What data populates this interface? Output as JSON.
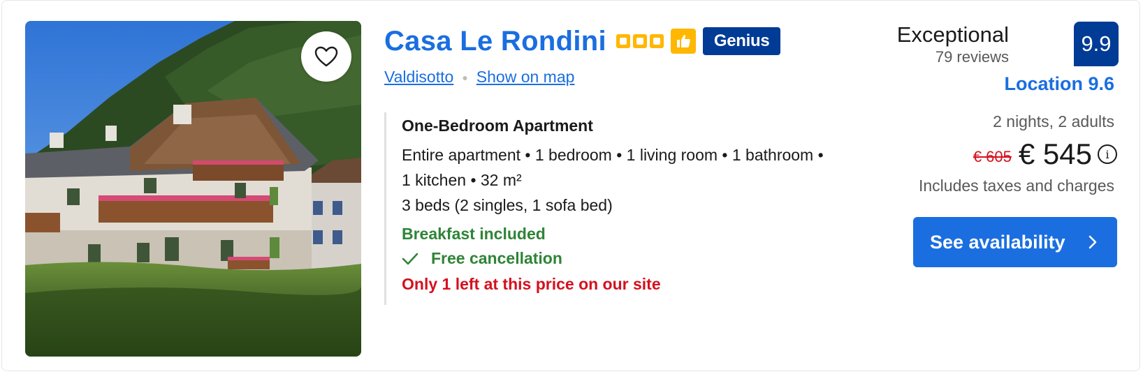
{
  "listing": {
    "name": "Casa Le Rondini",
    "star_rating": 3,
    "badges": {
      "preferred_icon": "thumbs-up-icon",
      "genius_label": "Genius"
    },
    "location": {
      "city": "Valdisotto",
      "map_link": "Show on map"
    },
    "photo": {
      "alt_icon": "property-photo",
      "favorite_icon": "heart-icon"
    }
  },
  "room": {
    "name": "One-Bedroom Apartment",
    "desc_line1": "Entire apartment • 1 bedroom • 1 living room • 1 bathroom •",
    "desc_line2": "1 kitchen • 32 m²",
    "beds": "3 beds (2 singles, 1 sofa bed)",
    "breakfast": "Breakfast included",
    "cancellation": "Free cancellation",
    "scarcity": "Only 1 left at this price on our site"
  },
  "review": {
    "word": "Exceptional",
    "count": "79 reviews",
    "score": "9.9",
    "location_score": "Location 9.6"
  },
  "price": {
    "stay": "2 nights, 2 adults",
    "old": "€ 605",
    "current": "€ 545",
    "info_icon": "i",
    "taxes": "Includes taxes and charges"
  },
  "cta": {
    "label": "See availability"
  },
  "colors": {
    "brand_blue": "#1a6ee0",
    "dark_blue": "#003b95",
    "star_yellow": "#ffb700",
    "green": "#2f8437",
    "red": "#d4111e"
  }
}
